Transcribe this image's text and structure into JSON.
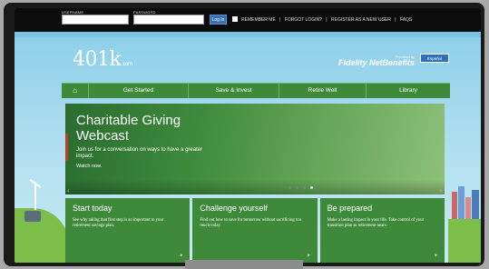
{
  "topbar": {
    "username_label": "USERNAME",
    "password_label": "PASSWORD",
    "login_label": "Log In",
    "remember_label": "REMEMBER ME",
    "forgot_label": "FORGOT LOGIN?",
    "register_label": "REGISTER AS A NEW USER",
    "faqs_label": "FAQS",
    "separator": "|"
  },
  "brand": {
    "logo_main": "401k",
    "logo_sub": ".com",
    "provided_by": "Provided by",
    "fidelity": "Fidelity NetBenefits",
    "espanol": "Español"
  },
  "nav": {
    "home_glyph": "⌂",
    "items": [
      "Get Started",
      "Save & Invest",
      "Retire Well",
      "Library"
    ]
  },
  "hero": {
    "title": "Charitable Giving Webcast",
    "text": "Join us for a conversation on ways to have a greater impact.",
    "link": "Watch now.",
    "prev": "‹",
    "next": "›"
  },
  "cards": [
    {
      "title": "Start today",
      "text": "See why taking that first step is so important to your retirement savings plan.",
      "arrow": "▸"
    },
    {
      "title": "Challenge yourself",
      "text": "Find out how to save for tomorrow without sacrificing too much today.",
      "arrow": "▸"
    },
    {
      "title": "Be prepared",
      "text": "Make a lasting impact in your life. Take control of your transition plan as retirement nears.",
      "arrow": "▸"
    }
  ],
  "colors": {
    "nav_green": "#3f8a3a",
    "sky": "#8fd0ea",
    "accent_blue": "#2f6fb5"
  }
}
